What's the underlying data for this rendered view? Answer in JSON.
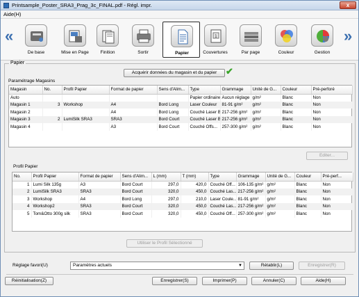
{
  "window": {
    "title": "Printsample_Poster_SRA3_Prag_3c_FINAL.pdf - Régl. impr.",
    "close_label": "x"
  },
  "menu": {
    "help": "Aide(H)"
  },
  "toolbar": {
    "prev_arrow": "«",
    "next_arrow": "»",
    "items": [
      {
        "label": "De base",
        "icon": "basic-settings-icon"
      },
      {
        "label": "Mise en Page",
        "icon": "layout-icon"
      },
      {
        "label": "Finition",
        "icon": "finishing-icon"
      },
      {
        "label": "Sortir",
        "icon": "output-icon"
      },
      {
        "label": "Papier",
        "icon": "paper-icon",
        "active": true
      },
      {
        "label": "Couvertures",
        "icon": "covers-icon"
      },
      {
        "label": "Par page",
        "icon": "per-page-icon"
      },
      {
        "label": "Couleur",
        "icon": "color-icon"
      },
      {
        "label": "Gestion",
        "icon": "management-icon"
      }
    ]
  },
  "papier": {
    "legend": "Papier",
    "acquire_button": "Acquérir données du magasin et du papier",
    "acquire_status_icon": "checkmark-icon",
    "trays_label": "Paramétrage Magasins",
    "trays": {
      "columns": [
        "Magasin",
        "No.",
        "Profil Papier",
        "Format de papier",
        "Sens d'Alim...",
        "Type",
        "Grammage",
        "Unité de G...",
        "Couleur",
        "Pré-perforé"
      ],
      "rows": [
        [
          "Auto",
          "",
          "",
          "",
          "",
          "Papier ordinaire",
          "Aucun réglage",
          "g/m²",
          "Blanc",
          "Non"
        ],
        [
          "Magasin 1",
          "3",
          "Workshop",
          "A4",
          "Bord Long",
          "Laser Couleur",
          "81-91 g/m²",
          "g/m²",
          "Blanc",
          "Non"
        ],
        [
          "Magasin 2",
          "",
          "",
          "A4",
          "Bord Long",
          "Couché Laser B",
          "217-256 g/m²",
          "g/m²",
          "Blanc",
          "Non"
        ],
        [
          "Magasin 3",
          "2",
          "LumiSilk SRA3",
          "SRA3",
          "Bord Court",
          "Couché Laser B",
          "217-256 g/m²",
          "g/m²",
          "Blanc",
          "Non"
        ],
        [
          "Magasin 4",
          "",
          "",
          "A3",
          "Bord Court",
          "Couché Offs...",
          "257-300 g/m²",
          "g/m²",
          "Blanc",
          "Non"
        ]
      ]
    },
    "edit_button": "Editer...",
    "profiles_label": "Profil Papier",
    "profiles": {
      "columns": [
        "No.",
        "Profil Papier",
        "Format de papier",
        "Sens d'Alim...",
        "L (mm)",
        "T (mm)",
        "Type",
        "Grammage",
        "Unité de G...",
        "Couleur",
        "Pré-perf..."
      ],
      "rows": [
        [
          "1",
          "Lumi Silk 135g",
          "A3",
          "Bord Court",
          "297,0",
          "420,0",
          "Couché Off...",
          "106-135 g/m²",
          "g/m²",
          "Blanc",
          "Non"
        ],
        [
          "2",
          "LumiSilk SRA3",
          "SRA3",
          "Bord Court",
          "320,0",
          "450,0",
          "Couché Las...",
          "217-256 g/m²",
          "g/m²",
          "Blanc",
          "Non"
        ],
        [
          "3",
          "Workshop",
          "A4",
          "Bord Long",
          "297,0",
          "210,0",
          "Laser Coule...",
          "81-91 g/m²",
          "g/m²",
          "Blanc",
          "Non"
        ],
        [
          "4",
          "Workshop2",
          "SRA3",
          "Bord Court",
          "320,0",
          "450,0",
          "Couché Las...",
          "217-256 g/m²",
          "g/m²",
          "Blanc",
          "Non"
        ],
        [
          "5",
          "Tom&Otto 300g silk",
          "SRA3",
          "Bord Court",
          "320,0",
          "450,0",
          "Couché Off...",
          "257-300 g/m²",
          "g/m²",
          "Blanc",
          "Non"
        ]
      ]
    },
    "use_profile_button": "Utiliser le Profil Sélectionné"
  },
  "favorites": {
    "label": "Réglage favori(U)",
    "value": "Paramètres actuels",
    "restore_button": "Rétablir(L)",
    "save_button": "Enregistrer(R)"
  },
  "footer": {
    "reset": "Réinitialisation(Z)",
    "save": "Enregistrer(S)",
    "print": "Imprimer(P)",
    "cancel": "Annuler(C)",
    "help": "Aide(H)"
  }
}
